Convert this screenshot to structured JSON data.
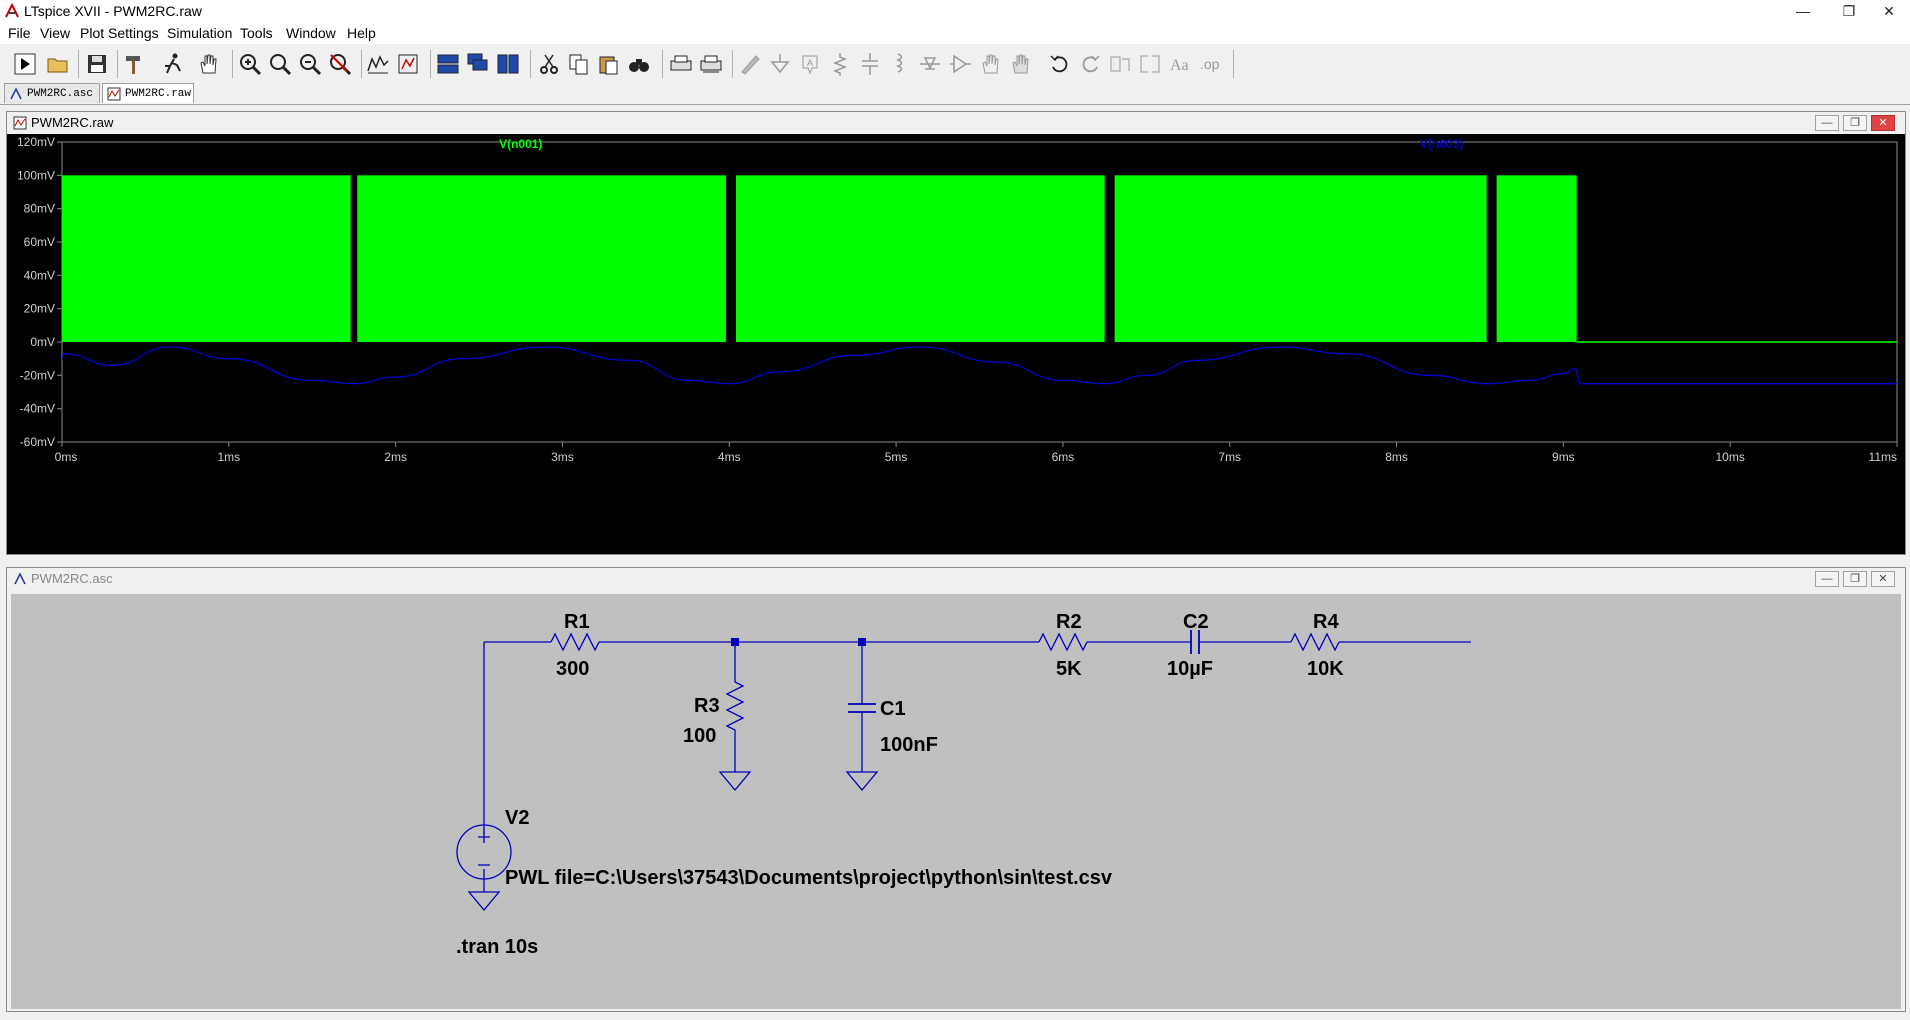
{
  "app": {
    "window_title": "LTspice XVII - PWM2RC.raw",
    "window_controls": {
      "minimize": "—",
      "restore": "❐",
      "close": "✕"
    }
  },
  "menu": [
    "File",
    "View",
    "Plot Settings",
    "Simulation",
    "Tools",
    "Window",
    "Help"
  ],
  "tabs": [
    {
      "label": "PWM2RC.asc",
      "icon": "schematic-icon",
      "active": false
    },
    {
      "label": "PWM2RC.raw",
      "icon": "waveform-icon",
      "active": true
    }
  ],
  "plot_window": {
    "title": "PWM2RC.raw",
    "icon": "waveform-icon",
    "background": "#000000"
  },
  "schematic_window": {
    "title": "PWM2RC.asc",
    "icon": "schematic-icon",
    "background": "#c0c0c0"
  },
  "chart_data": {
    "type": "line",
    "xlabel": "",
    "ylabel": "",
    "x_unit": "ms",
    "xlim": [
      0,
      11
    ],
    "ylim": [
      -60,
      120
    ],
    "y_unit": "mV",
    "x_ticks": [
      "0ms",
      "1ms",
      "2ms",
      "3ms",
      "4ms",
      "5ms",
      "6ms",
      "7ms",
      "8ms",
      "9ms",
      "10ms",
      "11ms"
    ],
    "y_ticks": [
      "120mV",
      "100mV",
      "80mV",
      "60mV",
      "40mV",
      "20mV",
      "0mV",
      "-20mV",
      "-40mV",
      "-60mV"
    ],
    "grid": false,
    "series": [
      {
        "name": "V(n001)",
        "color": "#00ff00",
        "style": "filled-pwm",
        "high_mV": 100,
        "low_mV": 0,
        "filled_bands_ms": [
          [
            0,
            1.73
          ],
          [
            1.77,
            3.98
          ],
          [
            4.04,
            6.25
          ],
          [
            6.31,
            8.54
          ],
          [
            8.6,
            9.08
          ]
        ],
        "x": [
          0,
          1.73,
          1.77,
          3.98,
          4.04,
          6.25,
          6.31,
          8.54,
          8.6,
          9.08,
          9.09,
          11
        ],
        "values": [
          100,
          100,
          100,
          100,
          100,
          100,
          100,
          100,
          100,
          100,
          0,
          0
        ]
      },
      {
        "name": "V(n003)",
        "color": "#0000cc",
        "style": "line",
        "x": [
          0,
          0.01,
          0.3,
          0.65,
          1.0,
          1.5,
          1.75,
          2.0,
          2.4,
          2.9,
          3.4,
          3.75,
          4.0,
          4.3,
          4.75,
          5.15,
          5.6,
          6.0,
          6.25,
          6.5,
          6.8,
          7.3,
          7.7,
          8.2,
          8.55,
          8.8,
          9.0,
          9.07,
          9.1,
          9.5,
          10.0,
          11.0
        ],
        "values": [
          -10,
          -7,
          -14,
          -3,
          -10,
          -23,
          -25,
          -21,
          -10,
          -3,
          -11,
          -23,
          -25,
          -18,
          -8,
          -3,
          -12,
          -23,
          -25,
          -20,
          -11,
          -3,
          -7,
          -20,
          -25,
          -23,
          -19,
          -16,
          -25,
          -25,
          -25,
          -25
        ]
      }
    ]
  },
  "schematic": {
    "components": [
      {
        "ref": "R1",
        "value": "300"
      },
      {
        "ref": "R3",
        "value": "100"
      },
      {
        "ref": "C1",
        "value": "100nF"
      },
      {
        "ref": "R2",
        "value": "5K"
      },
      {
        "ref": "C2",
        "value": "10µF"
      },
      {
        "ref": "R4",
        "value": "10K"
      },
      {
        "ref": "V2",
        "value": "PWL file=C:\\Users\\37543\\Documents\\project\\python\\sin\\test.csv"
      }
    ],
    "directive": ".tran 10s",
    "wire_color": "#0000bb"
  }
}
